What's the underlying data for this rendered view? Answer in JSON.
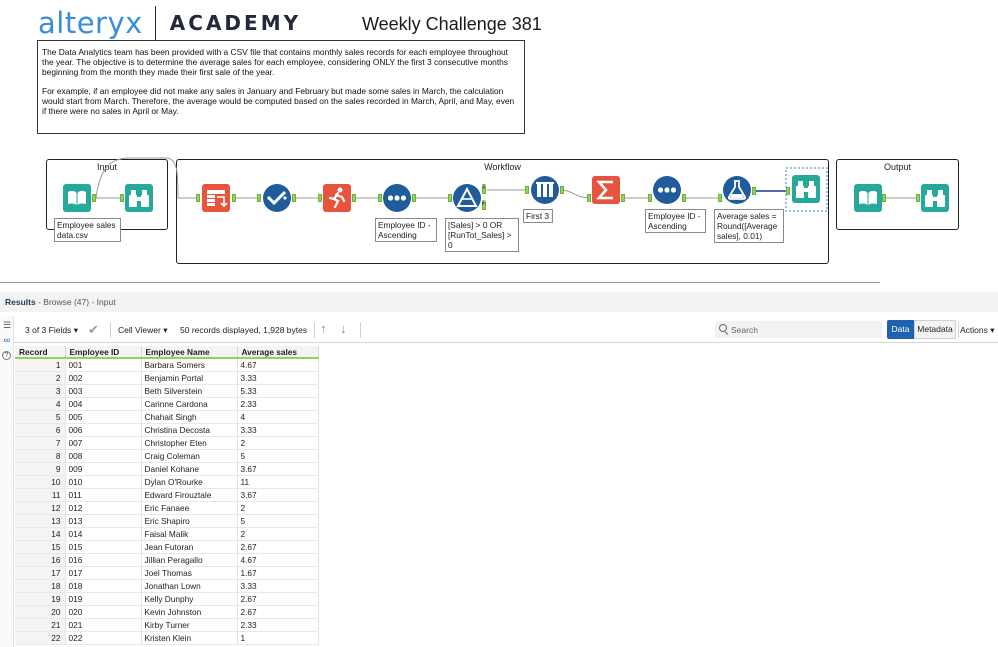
{
  "header": {
    "logo_word": "alteryx",
    "logo_academy": "ACADEMY",
    "challenge_title": "Weekly Challenge 381"
  },
  "description": {
    "paragraph1": "The Data Analytics team has been provided with a CSV file that contains monthly sales records for each employee throughout the year. The objective is to determine the average sales for each employee, considering ONLY the first 3 consecutive months beginning from the month they made their first sale of the year.",
    "paragraph2": "For example, if an employee did not make any sales in January and February but made some sales in March, the calculation would start from March. Therefore, the average would be computed based on the sales recorded in March, April, and May, even if there were no sales in April or May."
  },
  "containers": {
    "input": "Input",
    "workflow": "Workflow",
    "output": "Output"
  },
  "annotations": {
    "input_file": "Employee sales data.csv",
    "sort1": "Employee ID - Ascending",
    "filter": "[Sales] > 0 OR [RunTot_Sales] > 0",
    "sample": "First 3",
    "sort2": "Employee ID - Ascending",
    "formula": "Average sales = Round([Average sales], 0.01)"
  },
  "anchors": {
    "true_label": "T",
    "false_label": "F"
  },
  "tool_icons": {
    "input_data": "book-icon",
    "browse": "binoculars-icon",
    "transpose": "transpose-icon",
    "select": "select-check-icon",
    "running_total": "runner-icon",
    "sort": "sort-dots-icon",
    "filter": "filter-icon",
    "sample": "sample-icon",
    "summarize": "sigma-icon",
    "formula": "flask-icon"
  },
  "colors": {
    "tool_blue": "#1f6aa5",
    "tool_green": "#26a99a",
    "tool_orange": "#e8533d",
    "connector": "#1a3a8c",
    "anchor_green": "#8fd35a",
    "data_button": "#1f63b0",
    "logo_blue": "#3b8ed6"
  },
  "results": {
    "title": "Results",
    "subtitle": " - Browse (47) - Input",
    "fields_label": "3 of 3 Fields",
    "cell_viewer": "Cell Viewer",
    "records_info": "50 records displayed, 1,928 bytes",
    "search_placeholder": "Search",
    "data_btn": "Data",
    "metadata_btn": "Metadata",
    "actions": "Actions"
  },
  "table": {
    "columns": [
      "Record",
      "Employee ID",
      "Employee Name",
      "Average sales"
    ],
    "rows": [
      [
        "1",
        "001",
        "Barbara Somers",
        "4.67"
      ],
      [
        "2",
        "002",
        "Benjamin Portal",
        "3.33"
      ],
      [
        "3",
        "003",
        "Beth Silverstein",
        "5.33"
      ],
      [
        "4",
        "004",
        "Carinne Cardona",
        "2.33"
      ],
      [
        "5",
        "005",
        "Chahait Singh",
        "4"
      ],
      [
        "6",
        "006",
        "Christina Decosta",
        "3.33"
      ],
      [
        "7",
        "007",
        "Christopher Eten",
        "2"
      ],
      [
        "8",
        "008",
        "Craig Coleman",
        "5"
      ],
      [
        "9",
        "009",
        "Daniel Kohane",
        "3.67"
      ],
      [
        "10",
        "010",
        "Dylan O'Rourke",
        "11"
      ],
      [
        "11",
        "011",
        "Edward Firouztale",
        "3.67"
      ],
      [
        "12",
        "012",
        "Eric Fanaee",
        "2"
      ],
      [
        "13",
        "013",
        "Eric Shapiro",
        "5"
      ],
      [
        "14",
        "014",
        "Faisal Malik",
        "2"
      ],
      [
        "15",
        "015",
        "Jean Futoran",
        "2.67"
      ],
      [
        "16",
        "016",
        "Jillian Peragallo",
        "4.67"
      ],
      [
        "17",
        "017",
        "Joel Thomas",
        "1.67"
      ],
      [
        "18",
        "018",
        "Jonathan Lown",
        "3.33"
      ],
      [
        "19",
        "019",
        "Kelly Dunphy",
        "2.67"
      ],
      [
        "20",
        "020",
        "Kevin Johnston",
        "2.67"
      ],
      [
        "21",
        "021",
        "Kirby Turner",
        "2.33"
      ],
      [
        "22",
        "022",
        "Kristen Klein",
        "1"
      ]
    ]
  }
}
